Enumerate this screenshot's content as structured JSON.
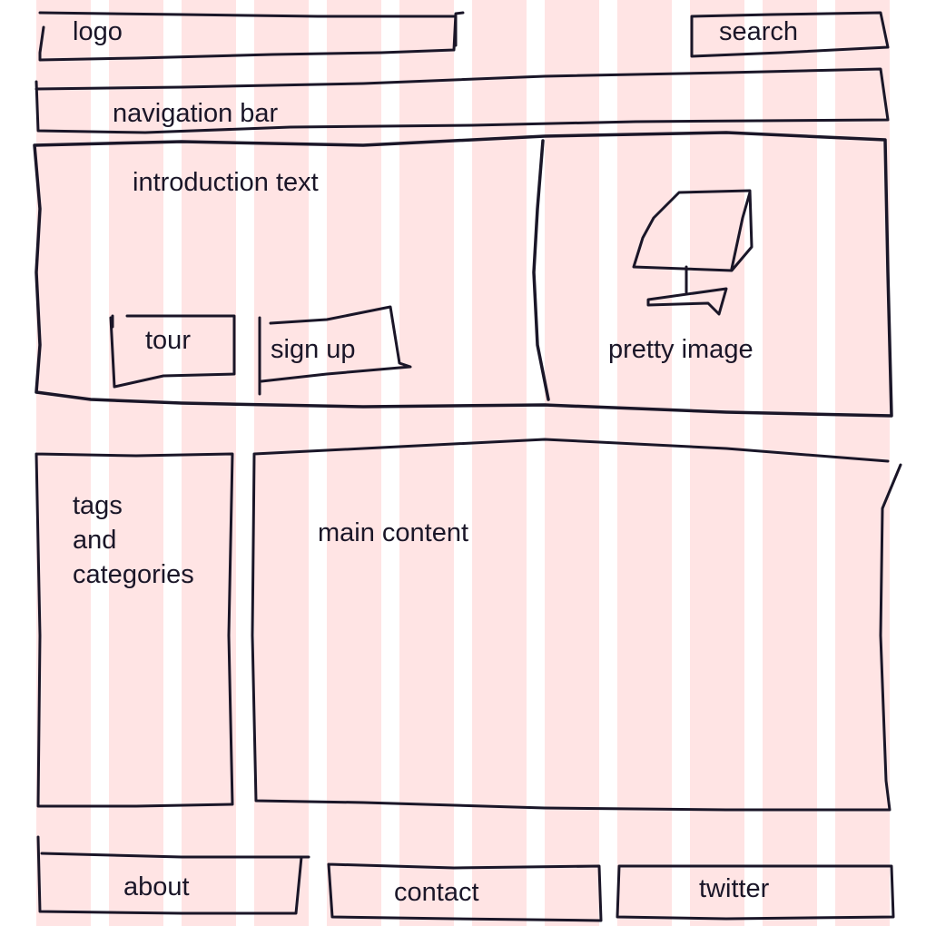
{
  "colors": {
    "background": "#ffffff",
    "grid_column": "#ffe4e4",
    "ink": "#1a1628"
  },
  "header": {
    "logo": "logo",
    "search": "search"
  },
  "nav": {
    "label": "navigation bar"
  },
  "hero": {
    "intro": "introduction text",
    "tour": "tour",
    "signup": "sign up",
    "image_label": "pretty image",
    "image_icon": "monitor-icon"
  },
  "sidebar": {
    "label": "tags\nand\ncategories"
  },
  "main": {
    "label": "main content"
  },
  "footer": {
    "about": "about",
    "contact": "contact",
    "twitter": "twitter"
  }
}
